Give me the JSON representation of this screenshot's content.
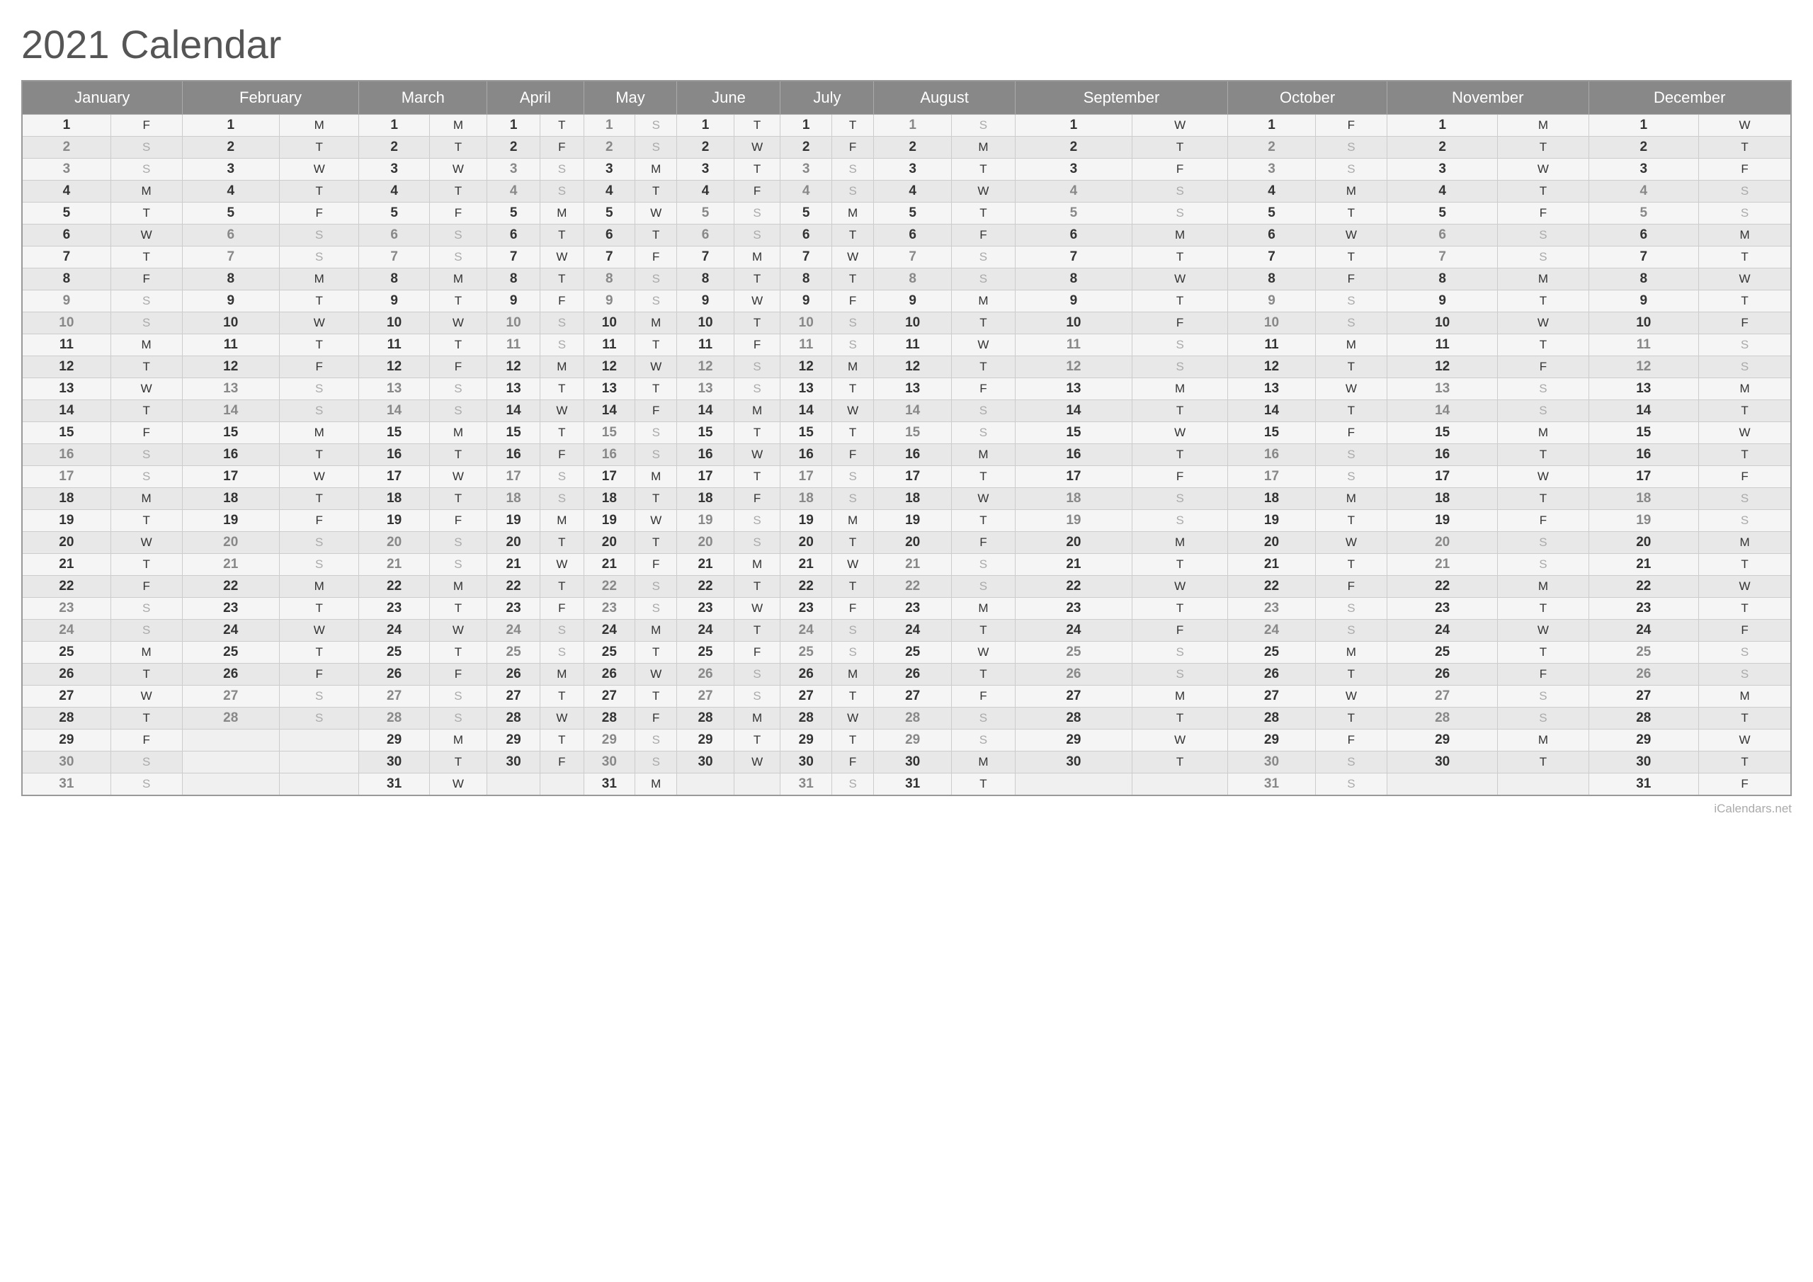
{
  "title": "2021 Calendar",
  "footer": "iCalendars.net",
  "months": [
    {
      "name": "January",
      "days": 31,
      "start": 4
    },
    {
      "name": "February",
      "days": 28,
      "start": 0
    },
    {
      "name": "March",
      "days": 31,
      "start": 0
    },
    {
      "name": "April",
      "days": 30,
      "start": 3
    },
    {
      "name": "May",
      "days": 31,
      "start": 5
    },
    {
      "name": "June",
      "days": 30,
      "start": 1
    },
    {
      "name": "July",
      "days": 31,
      "start": 3
    },
    {
      "name": "August",
      "days": 31,
      "start": 6
    },
    {
      "name": "September",
      "days": 30,
      "start": 2
    },
    {
      "name": "October",
      "days": 31,
      "start": 4
    },
    {
      "name": "November",
      "days": 30,
      "start": 0
    },
    {
      "name": "December",
      "days": 31,
      "start": 2
    }
  ],
  "day_letters": [
    "M",
    "T",
    "W",
    "T",
    "F",
    "S",
    "S"
  ]
}
